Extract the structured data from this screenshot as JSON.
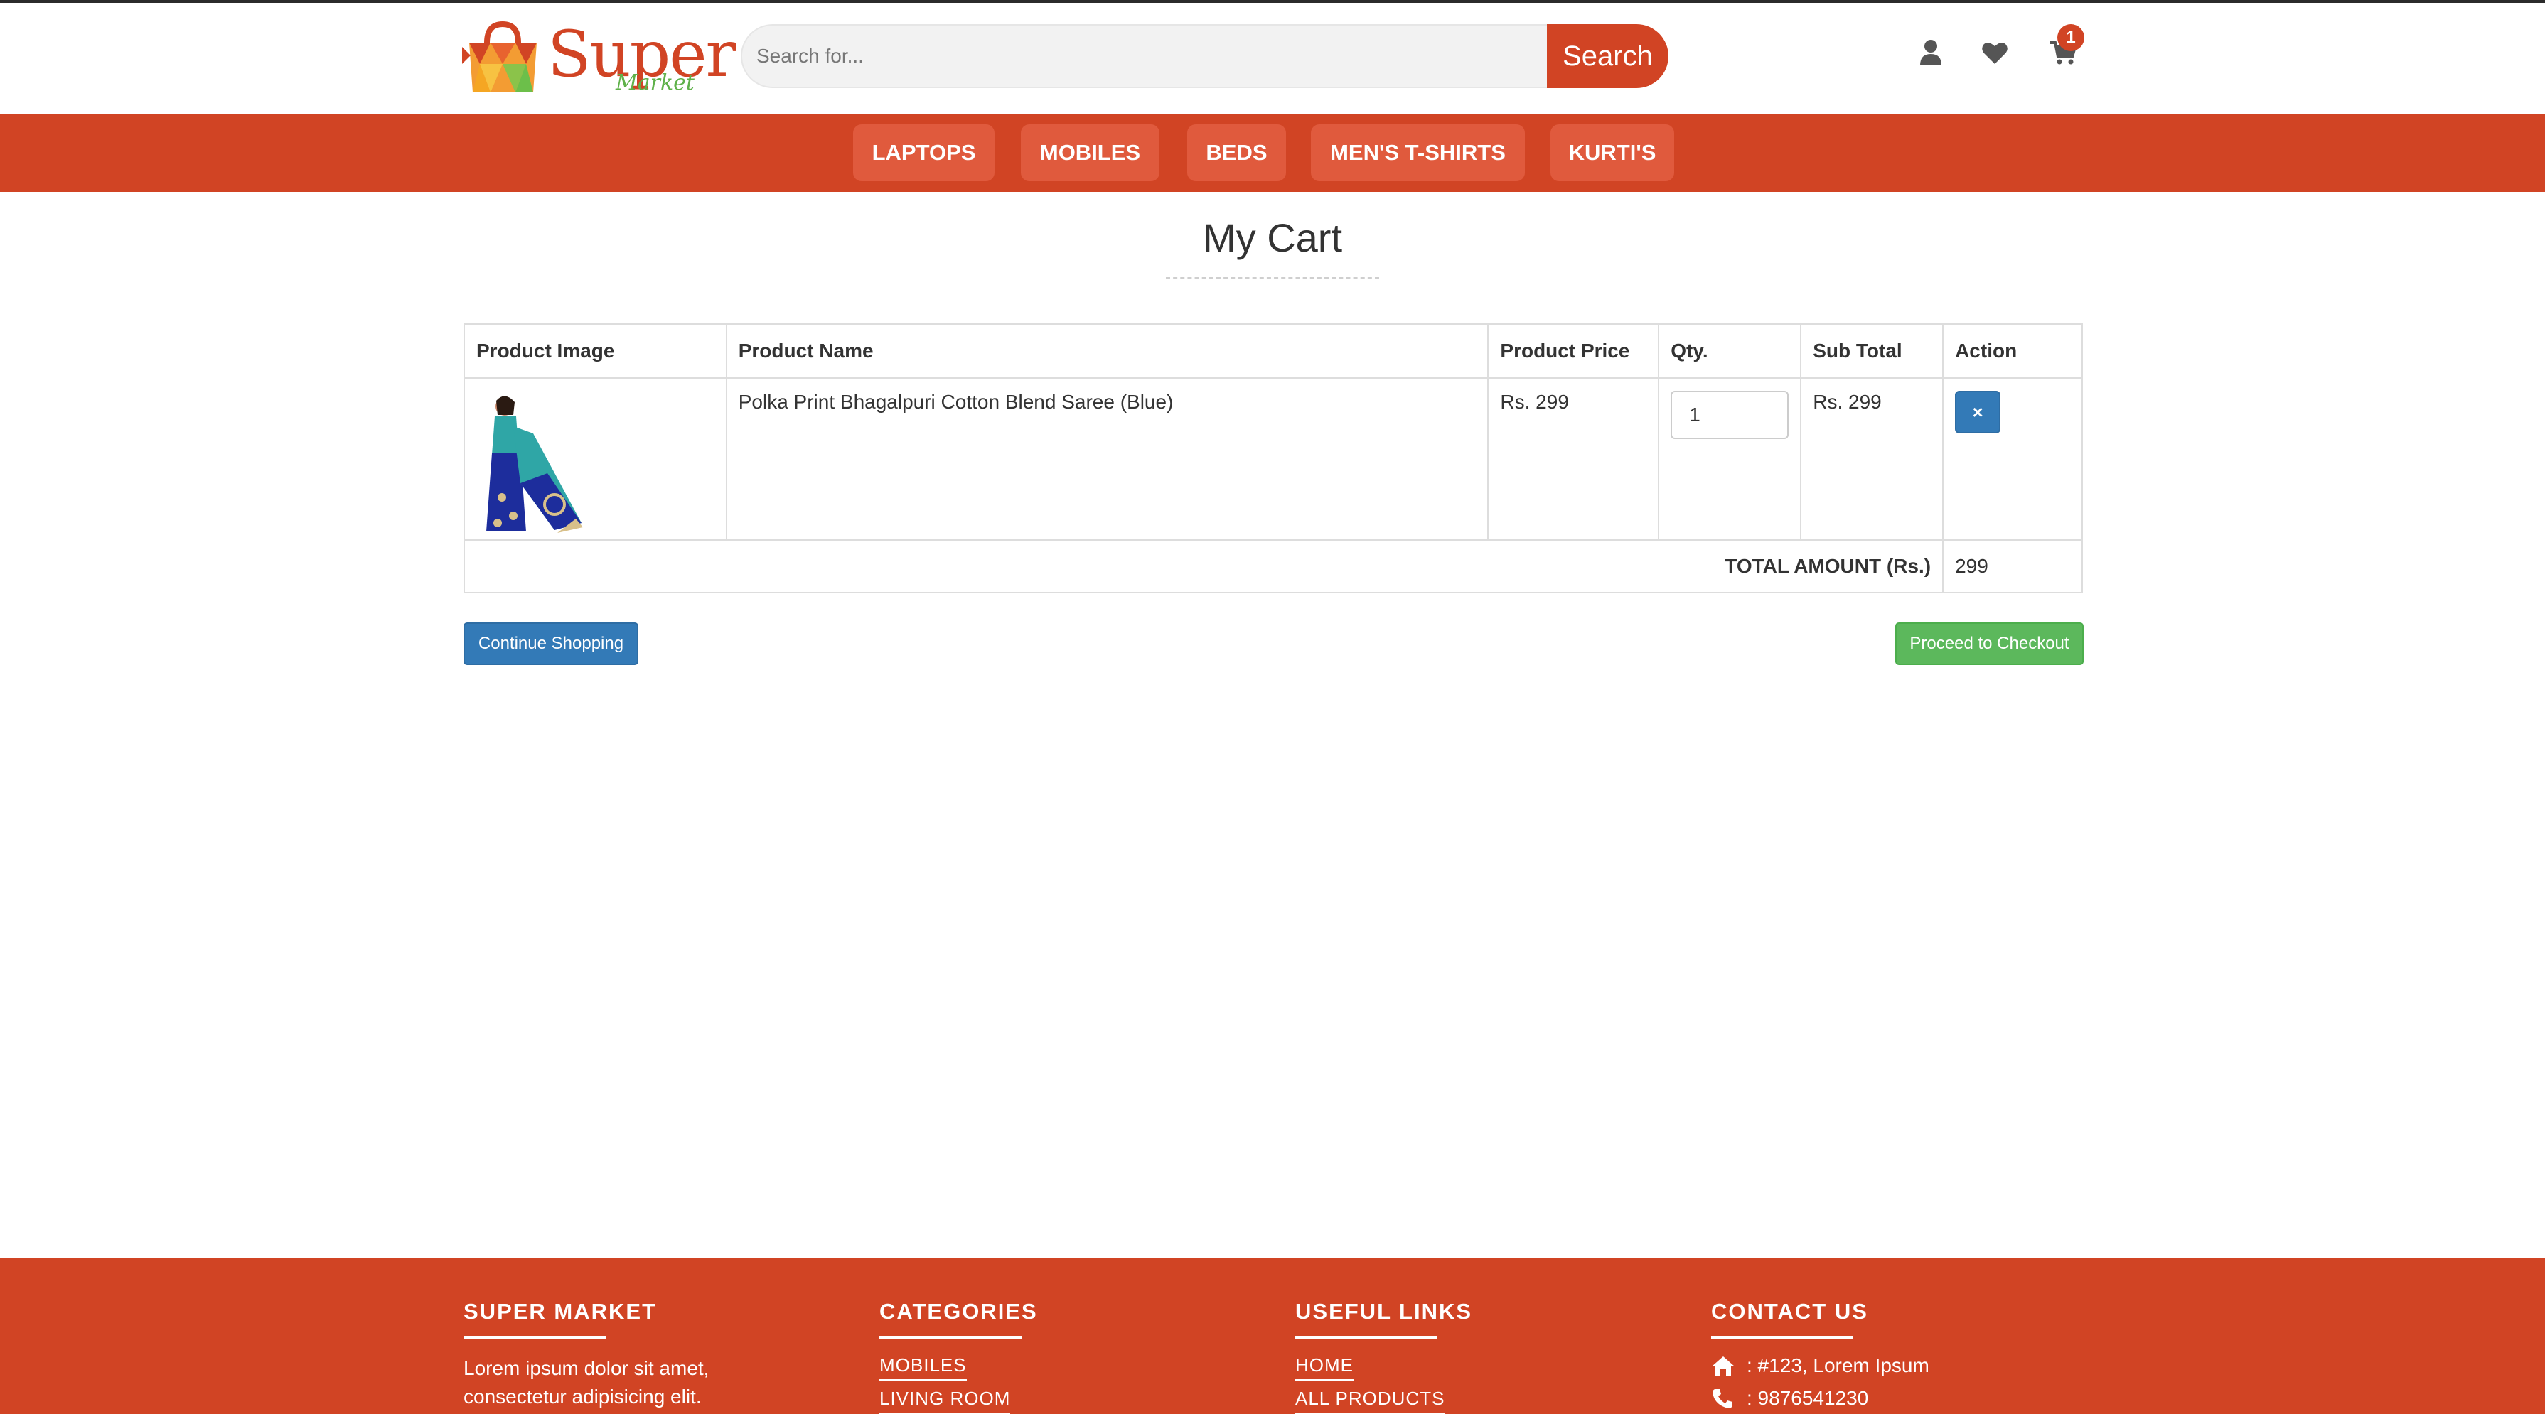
{
  "header": {
    "logo_text": "Super",
    "logo_subtext": "Market",
    "search_placeholder": "Search for...",
    "search_button": "Search",
    "cart_count": "1",
    "icons": [
      "user-icon",
      "heart-icon",
      "cart-icon"
    ]
  },
  "nav": {
    "items": [
      {
        "label": "LAPTOPS"
      },
      {
        "label": "MOBILES"
      },
      {
        "label": "BEDS"
      },
      {
        "label": "MEN'S T-SHIRTS"
      },
      {
        "label": "KURTI'S"
      }
    ]
  },
  "cart": {
    "title": "My Cart",
    "headers": {
      "image": "Product Image",
      "name": "Product Name",
      "price": "Product Price",
      "qty": "Qty.",
      "subtotal": "Sub Total",
      "action": "Action"
    },
    "items": [
      {
        "name": "Polka Print Bhagalpuri Cotton Blend Saree (Blue)",
        "price": "Rs. 299",
        "qty": "1",
        "subtotal": "Rs. 299",
        "remove_icon": "×"
      }
    ],
    "total_label": "TOTAL AMOUNT (Rs.)",
    "total_value": "299",
    "continue_button": "Continue Shopping",
    "checkout_button": "Proceed to Checkout"
  },
  "footer": {
    "about": {
      "heading": "SUPER MARKET",
      "text": "Lorem ipsum dolor sit amet, consectetur adipisicing elit."
    },
    "categories": {
      "heading": "CATEGORIES",
      "links": [
        "MOBILES",
        "LIVING ROOM"
      ]
    },
    "useful_links": {
      "heading": "USEFUL LINKS",
      "links": [
        "HOME",
        "ALL PRODUCTS"
      ]
    },
    "contact": {
      "heading": "CONTACT US",
      "address": ": #123, Lorem Ipsum",
      "phone": ": 9876541230"
    }
  },
  "colors": {
    "brand": "#d14424",
    "nav_item": "#e05a3d",
    "primary_button": "#337ab7",
    "success_button": "#5cb85c",
    "logo_green": "#5fb14a"
  }
}
